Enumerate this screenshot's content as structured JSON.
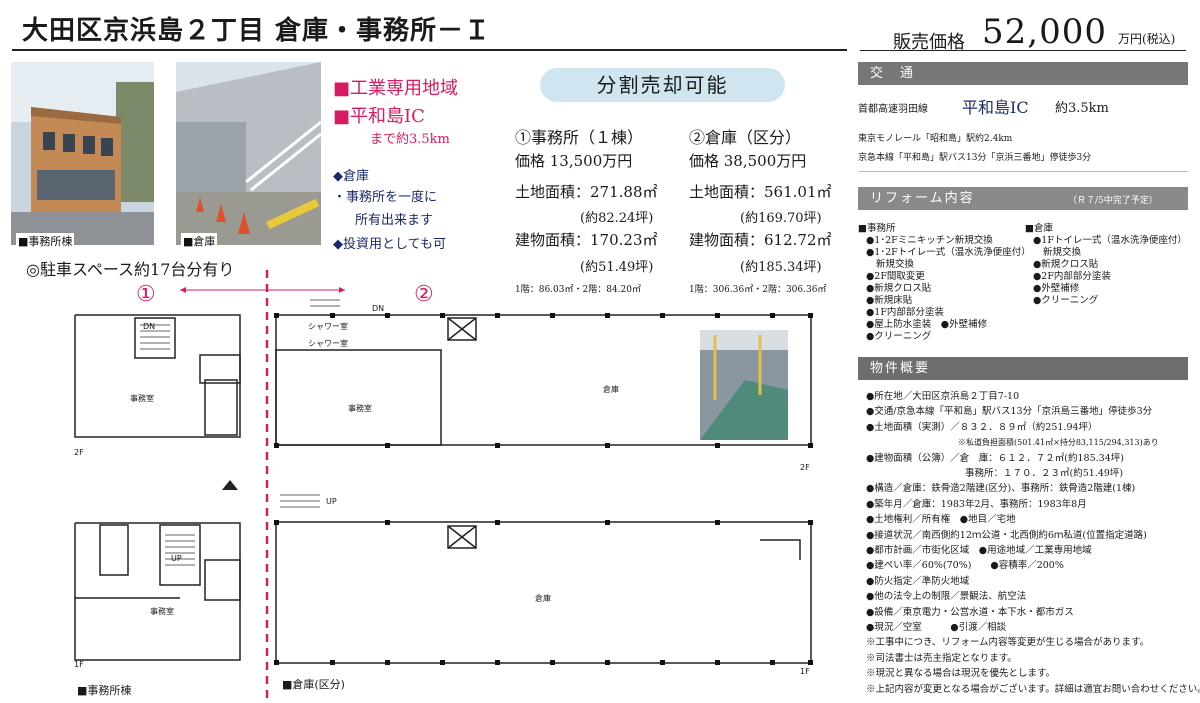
{
  "header": {
    "title": "大田区京浜島２丁目 倉庫・事務所－Ｉ",
    "price_label": "販売価格",
    "price_value": "52,000",
    "price_unit": "万円(税込)"
  },
  "photos": {
    "office_caption": "■事務所棟",
    "warehouse_caption": "■倉庫"
  },
  "features": {
    "zone": "■工業専用地域",
    "ic": "■平和島IC",
    "ic_distance": "まで約3.5km",
    "items": [
      "◆倉庫",
      "・事務所を一度に",
      "所有出来ます",
      "◆投資用としても可"
    ]
  },
  "split": {
    "banner": "分割売却可能",
    "office": {
      "heading": "①事務所（１棟）",
      "price": "価格 13,500万円",
      "land": "土地面積：271.88㎡",
      "land_tsubo": "(約82.24坪)",
      "building": "建物面積：170.23㎡",
      "building_tsubo": "(約51.49坪)",
      "floors": "1階：86.03㎡・2階：84.20㎡"
    },
    "warehouse": {
      "heading": "②倉庫（区分）",
      "price": "価格 38,500万円",
      "land": "土地面積：561.01㎡",
      "land_tsubo": "(約169.70坪)",
      "building": "建物面積：612.72㎡",
      "building_tsubo": "(約185.34坪)",
      "floors": "1階：306.36㎡・2階：306.36㎡"
    }
  },
  "parking": "◎駐車スペース約17台分有り",
  "plan": {
    "marker1": "①",
    "marker2": "②",
    "office_room": "事務室",
    "warehouse_room": "倉庫",
    "dn": "DN",
    "up": "UP",
    "shower": "シャワー室",
    "floor_2f": "2F",
    "floor_1f": "1F",
    "office_caption": "■事務所棟",
    "warehouse_caption": "■倉庫(区分)"
  },
  "traffic": {
    "heading": "交　通",
    "route": "首都高速羽田線",
    "ic": "平和島IC",
    "distance": "約3.5km",
    "monorail": "東京モノレール「昭和島」駅約2.4km",
    "keikyu": "京急本線「平和島」駅バス13分「京浜三番地」停徒歩3分"
  },
  "reform": {
    "heading": "リフォーム内容",
    "note": "（Ｒ７/5中完了予定）",
    "office_head": "■事務所",
    "office_items": [
      "●1･2Fミニキッチン新規交換",
      "●1･2Fトイレ一式（温水洗浄便座付）",
      "新規交換",
      "●2F間取変更",
      "●新規クロス貼",
      "●新規床貼",
      "●1F内部部分塗装",
      "●屋上防水塗装　●外壁補修",
      "●クリーニング"
    ],
    "warehouse_head": "■倉庫",
    "warehouse_items": [
      "●1Fトイレ一式（温水洗浄便座付）",
      "新規交換",
      "●新規クロス貼",
      "●2F内部部分塗装",
      "●外壁補修",
      "●クリーニング"
    ]
  },
  "overview": {
    "heading": "物件概要",
    "lines": [
      "●所在地／大田区京浜島２丁目7-10",
      "●交通/京急本線「平和島」駅バス13分「京浜島三番地」停徒歩3分",
      "●土地面積（実測）／８３２．８９㎡（約251.94坪）",
      "※私道負担面積(501.41㎡×持分83,115/294,313)あり",
      "●建物面積（公簿）／倉　庫：６１２．７２㎡(約185.34坪)",
      "事務所：１７０．２３㎡(約51.49坪)",
      "●構造／倉庫：鉄骨造2階建(区分)、事務所：鉄骨造2階建(1棟)",
      "●築年月／倉庫：1983年2月、事務所：1983年8月",
      "●土地権利／所有権　●地目／宅地",
      "●接道状況／南西側約12ｍ公道・北西側約6ｍ私道(位置指定道路)",
      "●都市計画／市街化区域　●用途地域／工業専用地域",
      "●建ぺい率／60%(70%)　　●容積率／200%",
      "●防火指定／準防火地域",
      "●他の法令上の制限／景観法、航空法",
      "●設備／東京電力・公営水道・本下水・都市ガス",
      "●現況／空室　　　●引渡／相談",
      "※工事中につき、リフォーム内容等変更が生じる場合があります。",
      "※司法書士は売主指定となります。",
      "※現況と異なる場合は現況を優先とします。",
      "※上記内容が変更となる場合がございます。詳細は適宜お問い合わせください。"
    ]
  },
  "colors": {
    "accent_pink": "#d81b60",
    "banner_blue": "#cfe5ef",
    "section_gray": "#777777",
    "navy": "#1b2a6b"
  }
}
